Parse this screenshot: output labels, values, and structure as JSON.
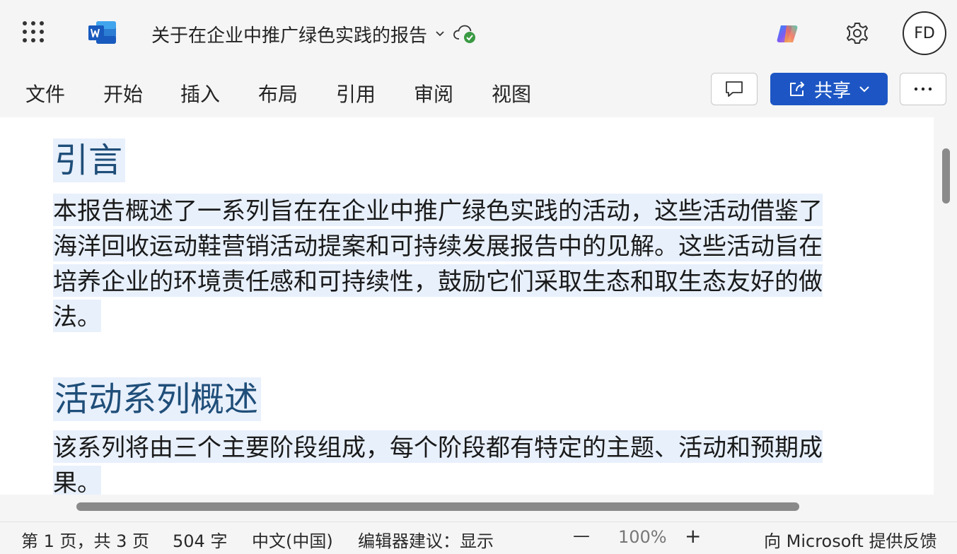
{
  "app": {
    "doc_title": "关于在企业中推广绿色实践的报告",
    "user_initials": "FD"
  },
  "ribbon": {
    "tabs": [
      "文件",
      "开始",
      "插入",
      "布局",
      "引用",
      "审阅",
      "视图"
    ],
    "share_label": "共享"
  },
  "document": {
    "sections": [
      {
        "heading": "引言",
        "lines": [
          "本报告概述了一系列旨在在企业中推广绿色实践的活动，这些活动借鉴了",
          "海洋回收运动鞋营销活动提案和可持续发展报告中的见解。这些活动旨在",
          "培养企业的环境责任感和可持续性，鼓励它们采取生态和取生态友好的做",
          "法。"
        ]
      },
      {
        "heading": "活动系列概述",
        "lines": [
          "该系列将由三个主要阶段组成，每个阶段都有特定的主题、活动和预期成",
          "果。"
        ]
      }
    ]
  },
  "status": {
    "page": "第 1 页，共 3 页",
    "words": "504 字",
    "language": "中文(中国)",
    "editor": "编辑器建议：显示",
    "zoom_out": "—",
    "zoom": "100%",
    "zoom_in": "+",
    "feedback": "向 Microsoft 提供反馈"
  },
  "colors": {
    "accent": "#1d56c4",
    "heading": "#1f4e79",
    "selection": "#e8f0fc",
    "word_blue": "#185abd",
    "sync_green": "#3a9a43"
  },
  "icons": {
    "launcher": "app-launcher-icon",
    "word": "word-logo-icon",
    "chevron": "chevron-down-icon",
    "cloud": "cloud-saved-icon",
    "copilot": "copilot-icon",
    "settings": "gear-icon",
    "comment": "comment-icon",
    "share": "share-icon",
    "more": "more-icon"
  }
}
